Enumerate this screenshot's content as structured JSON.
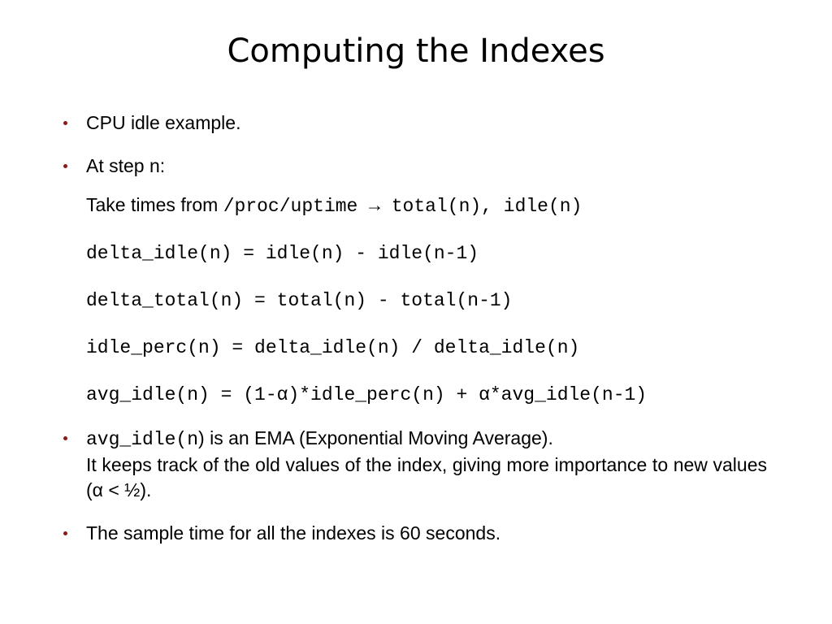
{
  "title": "Computing the Indexes",
  "bullets": {
    "b1": "CPU idle example.",
    "b2_lead": "At step n:",
    "b2_sub1_prefix": "Take times from ",
    "b2_sub1_code": "/proc/uptime → total(n), idle(n)",
    "b2_sub2": "delta_idle(n) = idle(n) - idle(n-1)",
    "b2_sub3": "delta_total(n) = total(n) - total(n-1)",
    "b2_sub4": "idle_perc(n) = delta_idle(n) / delta_idle(n)",
    "b2_sub5": "avg_idle(n) = (1-α)*idle_perc(n) + α*avg_idle(n-1)",
    "b3_code": "avg_idle(n",
    "b3_rest_line1": ") is an EMA (Exponential Moving Average).",
    "b3_line2": "It keeps track of the old values of the index, giving more importance to new values (α < ½).",
    "b4": "The sample time for all the indexes is 60 seconds."
  }
}
